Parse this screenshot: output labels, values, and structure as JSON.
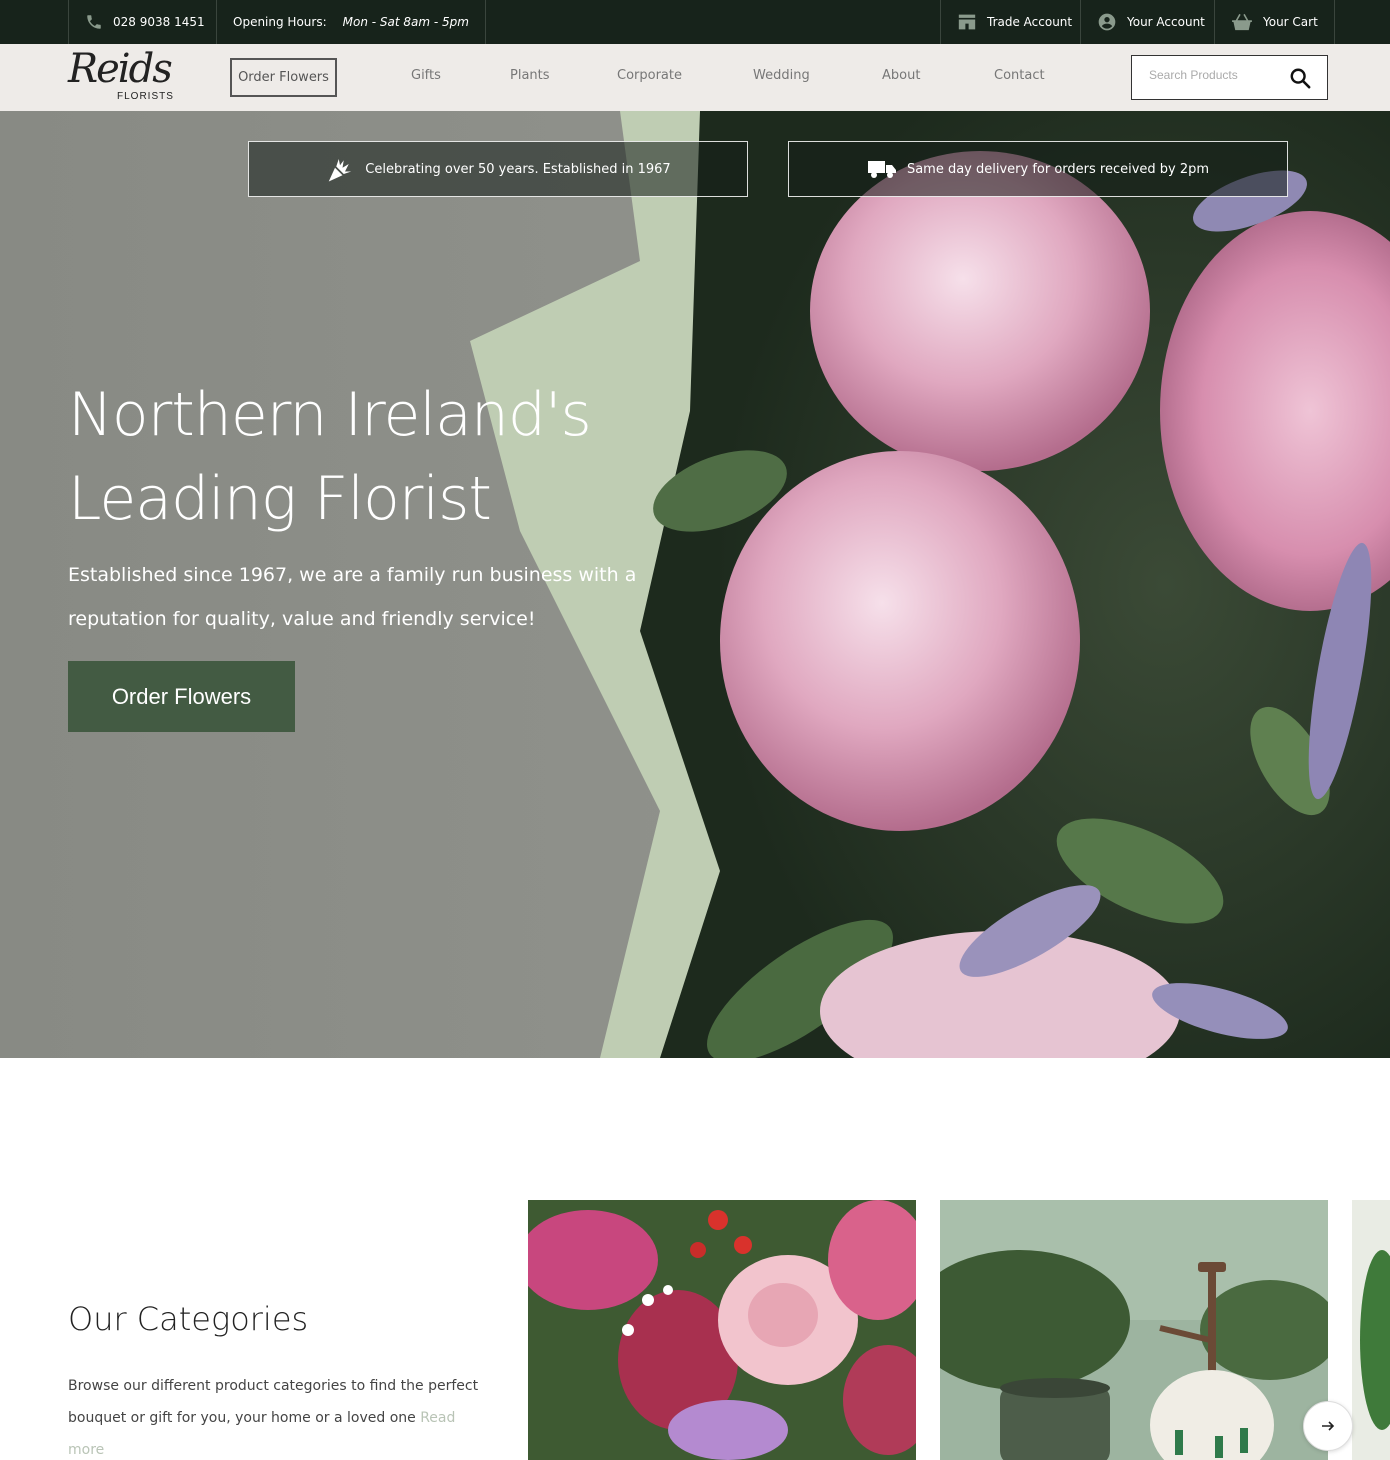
{
  "topbar": {
    "phone": "028 9038 1451",
    "hours_label": "Opening Hours:",
    "hours_value": "Mon - Sat 8am - 5pm",
    "trade_account": "Trade Account",
    "your_account": "Your Account",
    "your_cart": "Your Cart"
  },
  "header": {
    "logo_script": "Reids",
    "logo_sub": "FLORISTS",
    "order_flowers": "Order Flowers",
    "nav": [
      "Gifts",
      "Plants",
      "Corporate",
      "Wedding",
      "About",
      "Contact"
    ],
    "search_placeholder": "Search Products"
  },
  "hero": {
    "badge_1": "Celebrating over 50 years. Established in 1967",
    "badge_2": "Same day delivery for orders received by 2pm",
    "title_line_1": "Northern Ireland's",
    "title_line_2": "Leading Florist",
    "subtitle": "Established since 1967, we are a family run business with a reputation for quality, value and friendly service!",
    "cta": "Order Flowers"
  },
  "categories": {
    "title": "Our Categories",
    "description": "Browse our different product categories to find the perfect bouquet or gift for you, your home or a loved one",
    "read_more": "Read more"
  },
  "colors": {
    "topbar_bg": "#17231b",
    "header_bg": "#eeebe8",
    "accent_green": "#435b43"
  }
}
